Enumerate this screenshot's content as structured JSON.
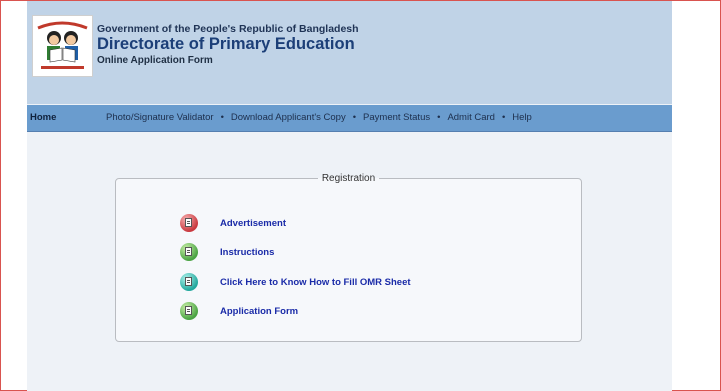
{
  "header": {
    "government": "Government of the People's Republic of Bangladesh",
    "directorate": "Directorate of Primary Education",
    "subtitle": "Online Application Form"
  },
  "nav": {
    "home": "Home",
    "items": [
      "Photo/Signature Validator",
      "Download Applicant's Copy",
      "Payment Status",
      "Admit Card",
      "Help"
    ],
    "separator": "•"
  },
  "registration": {
    "legend": "Registration",
    "links": [
      {
        "label": "Advertisement",
        "icon": "document-icon",
        "color": "#c9393f"
      },
      {
        "label": "Instructions",
        "icon": "document-icon",
        "color": "#4aa343"
      },
      {
        "label": "Click Here to Know How to Fill OMR Sheet",
        "icon": "document-icon",
        "color": "#22a89d"
      },
      {
        "label": "Application Form",
        "icon": "document-icon",
        "color": "#4aa343"
      }
    ]
  },
  "colors": {
    "header_bg": "#c0d3e7",
    "nav_bg": "#6a9cce",
    "link": "#1a2ba8",
    "title": "#1c3f78"
  }
}
